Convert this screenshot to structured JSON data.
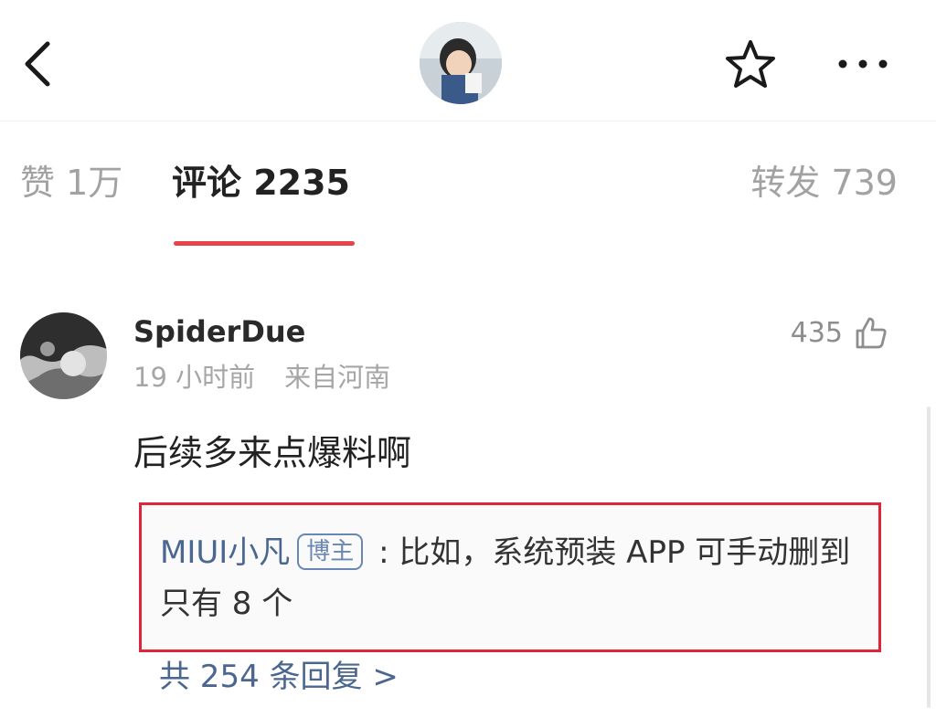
{
  "header": {
    "back": "chevron-left-icon",
    "avatar": "profile-avatar",
    "favorite": "star-icon",
    "more": "more-horizontal-icon"
  },
  "tabs": {
    "likes_label": "赞 1万",
    "comments_label": "评论 2235",
    "reposts_label": "转发 739",
    "accent_color": "#e8424a"
  },
  "comment": {
    "username": "SpiderDue",
    "time": "19 小时前",
    "location": "来自河南",
    "likes": "435",
    "text": "后续多来点爆料啊",
    "reply": {
      "username": "MIUI小凡",
      "badge": "博主",
      "colon": " : ",
      "text": "比如，系统预装 APP 可手动删到只有 8 个",
      "highlight_color": "#e0253a"
    },
    "reply_count": "共 254 条回复 >"
  }
}
